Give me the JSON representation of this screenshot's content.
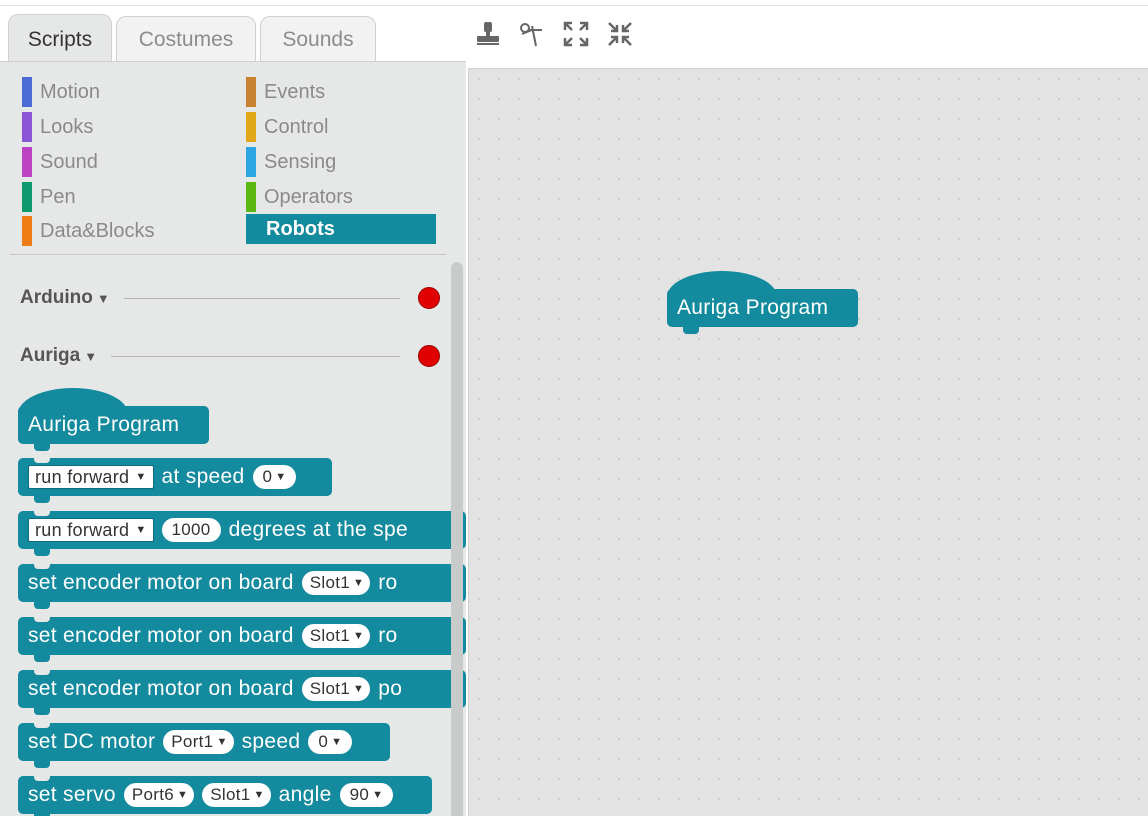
{
  "tabs": [
    {
      "label": "Scripts",
      "active": true
    },
    {
      "label": "Costumes",
      "active": false
    },
    {
      "label": "Sounds",
      "active": false
    }
  ],
  "toolbar": {
    "icons": [
      "duplicate-stamp-icon",
      "cut-scissors-icon",
      "grow-icon",
      "shrink-icon"
    ]
  },
  "categories": {
    "left": [
      {
        "label": "Motion",
        "color": "#4a6cd4"
      },
      {
        "label": "Looks",
        "color": "#8a55d7"
      },
      {
        "label": "Sound",
        "color": "#bb42c3"
      },
      {
        "label": "Pen",
        "color": "#0e9a6c"
      },
      {
        "label": "Data&Blocks",
        "color": "#ee7d16"
      }
    ],
    "right": [
      {
        "label": "Events",
        "color": "#c88330"
      },
      {
        "label": "Control",
        "color": "#e1a91a"
      },
      {
        "label": "Sensing",
        "color": "#2ca5e2"
      },
      {
        "label": "Operators",
        "color": "#5cb712"
      },
      {
        "label": "Robots",
        "color": "#138a9e",
        "selected": true
      }
    ]
  },
  "extensions": [
    {
      "name": "Arduino",
      "status_color": "#e00000"
    },
    {
      "name": "Auriga",
      "status_color": "#e00000"
    }
  ],
  "palette_blocks": {
    "hat": "Auriga Program",
    "run_at_speed": {
      "dropdown": "run forward",
      "text": "at speed",
      "value": "0"
    },
    "run_degrees": {
      "dropdown": "run forward",
      "value": "1000",
      "text": "degrees at the spe"
    },
    "encoder1": {
      "text": "set encoder motor on board",
      "slot": "Slot1",
      "tail": "ro"
    },
    "encoder2": {
      "text": "set encoder motor on board",
      "slot": "Slot1",
      "tail": "ro"
    },
    "encoder3": {
      "text": "set encoder motor on board",
      "slot": "Slot1",
      "tail": "po"
    },
    "dc_motor": {
      "text1": "set DC motor",
      "port": "Port1",
      "text2": "speed",
      "value": "0"
    },
    "servo": {
      "text1": "set servo",
      "port": "Port6",
      "slot": "Slot1",
      "text2": "angle",
      "value": "90"
    }
  },
  "script_area": {
    "hat_label": "Auriga Program"
  },
  "colors": {
    "block": "#138a9e",
    "palette_bg": "#e6e8e8",
    "script_bg": "#e3e3e3",
    "status_dot": "#e00000"
  }
}
